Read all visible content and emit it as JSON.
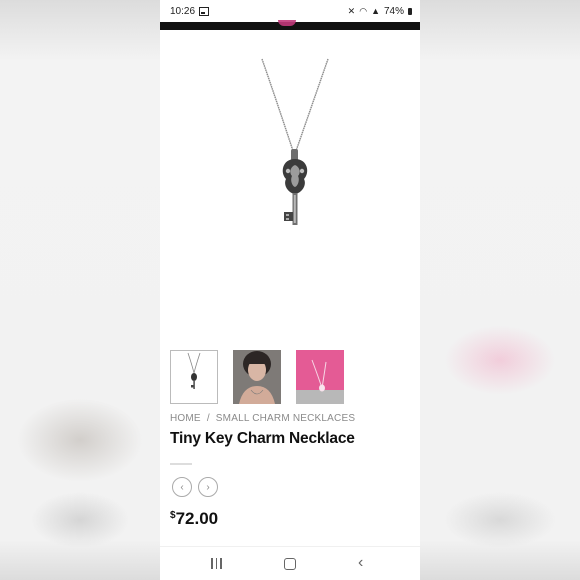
{
  "status_bar": {
    "time": "10:26",
    "battery": "74%",
    "icons": [
      "gallery-icon",
      "mute-icon",
      "wifi-icon",
      "signal-icon",
      "battery-icon"
    ]
  },
  "product": {
    "breadcrumb": {
      "home": "HOME",
      "separator": "/",
      "category": "SMALL CHARM NECKLACES"
    },
    "title": "Tiny Key Charm Necklace",
    "price_currency": "$",
    "price_amount": "72.00",
    "thumbnails": [
      "necklace-photo",
      "model-photo",
      "pink-packaging-photo"
    ],
    "prev_icon": "chevron-left-icon",
    "next_icon": "chevron-right-icon"
  },
  "nav_bar": {
    "icons": [
      "recents-icon",
      "home-icon",
      "back-icon"
    ]
  },
  "colors": {
    "accent_pink": "#e25b94",
    "top_band": "#111111",
    "text": "#111111",
    "muted": "#8a8a8a"
  }
}
